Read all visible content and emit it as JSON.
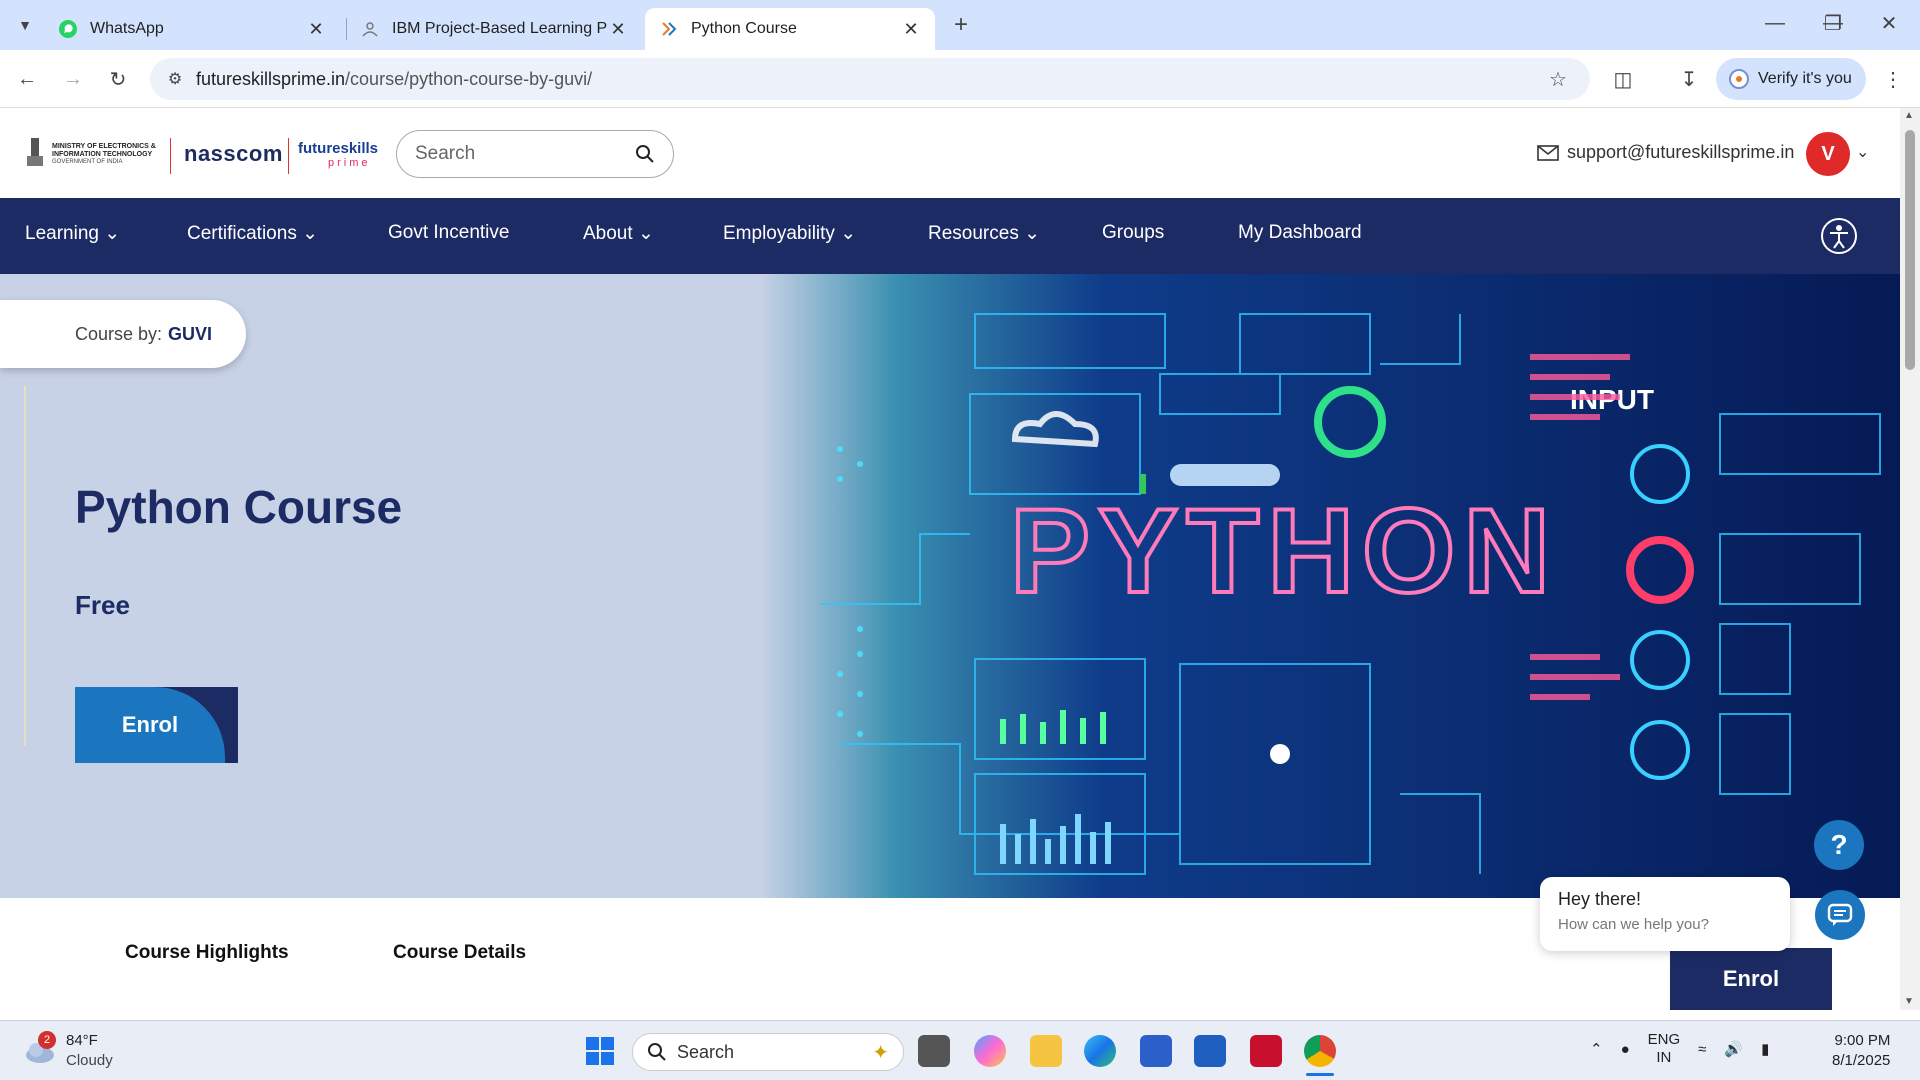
{
  "browser": {
    "tabs": [
      {
        "title": "WhatsApp",
        "active": false
      },
      {
        "title": "IBM Project-Based Learning Pro",
        "active": false
      },
      {
        "title": "Python Course",
        "active": true
      }
    ],
    "new_tab_label": "+",
    "url_host": "futureskillsprime.in",
    "url_path": "/course/python-course-by-guvi/",
    "verify_label": "Verify it's you"
  },
  "header": {
    "logo_meity": "MINISTRY OF ELECTRONICS & INFORMATION TECHNOLOGY",
    "logo_meity_sub": "GOVERNMENT OF INDIA",
    "logo_nasscom": "nasscom",
    "logo_fsp_top": "futureskills",
    "logo_fsp_bottom": "prime",
    "search_placeholder": "Search",
    "support_email": "support@futureskillsprime.in",
    "avatar_initial": "V"
  },
  "nav": {
    "items": [
      {
        "label": "Learning",
        "dropdown": true
      },
      {
        "label": "Certifications",
        "dropdown": true
      },
      {
        "label": "Govt Incentive",
        "dropdown": false
      },
      {
        "label": "About",
        "dropdown": true
      },
      {
        "label": "Employability",
        "dropdown": true
      },
      {
        "label": "Resources",
        "dropdown": true
      },
      {
        "label": "Groups",
        "dropdown": false
      },
      {
        "label": "My Dashboard",
        "dropdown": false
      }
    ]
  },
  "hero": {
    "course_by_label": "Course by:",
    "course_by_name": "GUVI",
    "title": "Python Course",
    "price": "Free",
    "enrol_label": "Enrol",
    "art_text_word": "PYTHON",
    "art_text_input": "INPUT"
  },
  "course_tabs": {
    "highlights": "Course Highlights",
    "details": "Course Details",
    "enrol_label": "Enrol"
  },
  "chat": {
    "help_symbol": "?",
    "greeting": "Hey there!",
    "prompt": "How can we help you?"
  },
  "taskbar": {
    "weather_temp": "84°F",
    "weather_desc": "Cloudy",
    "weather_badge": "2",
    "search_label": "Search",
    "lang_top": "ENG",
    "lang_bottom": "IN",
    "time": "9:00 PM",
    "date": "8/1/2025"
  },
  "colors": {
    "nav_bg": "#1d2b64",
    "brand_blue": "#1b76bf",
    "avatar_red": "#e02a2a"
  }
}
